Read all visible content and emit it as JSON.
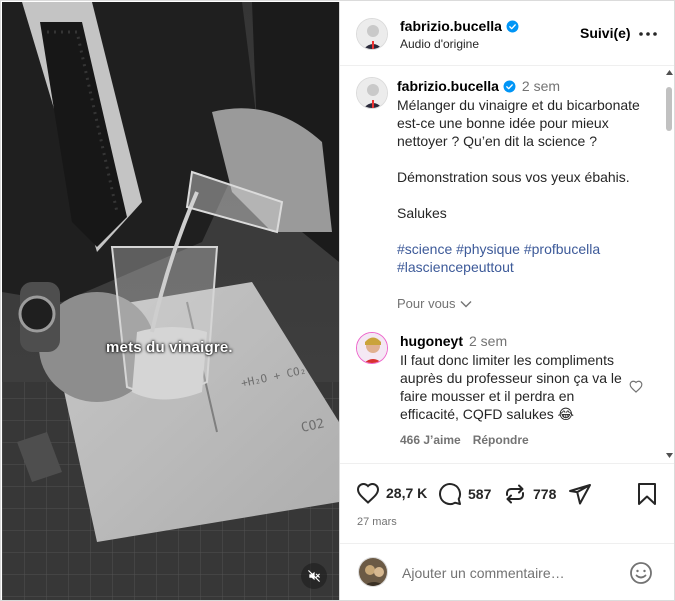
{
  "header": {
    "username": "fabrizio.bucella",
    "audio": "Audio d'origine",
    "follow_label": "Suivi(e)"
  },
  "video": {
    "caption": "mets du vinaigre."
  },
  "post": {
    "username": "fabrizio.bucella",
    "time": "2 sem",
    "paragraphs": [
      "Mélanger du vinaigre et du bicarbonate est-ce une bonne idée pour mieux nettoyer ? Qu’en dit la science ?",
      "Démonstration sous vos yeux ébahis.",
      "Salukes"
    ],
    "hashtags": "#science #physique #profbucella #lasciencepeuttout",
    "pour_vous": "Pour vous"
  },
  "comment": {
    "username": "hugoneyt",
    "time": "2 sem",
    "text": "Il faut donc limiter les compliments auprès du professeur sinon ça va le faire mousser et il perdra en efficacité, CQFD salukes 😂",
    "likes": "466 J’aime",
    "reply": "Répondre"
  },
  "actions": {
    "likes": "28,7 K",
    "comments": "587",
    "reposts": "778",
    "date": "27 mars"
  },
  "add_comment": {
    "placeholder": "Ajouter un commentaire…"
  },
  "colors": {
    "verified": "#0095f6",
    "link": "#3d5a99",
    "muted": "#737373"
  }
}
